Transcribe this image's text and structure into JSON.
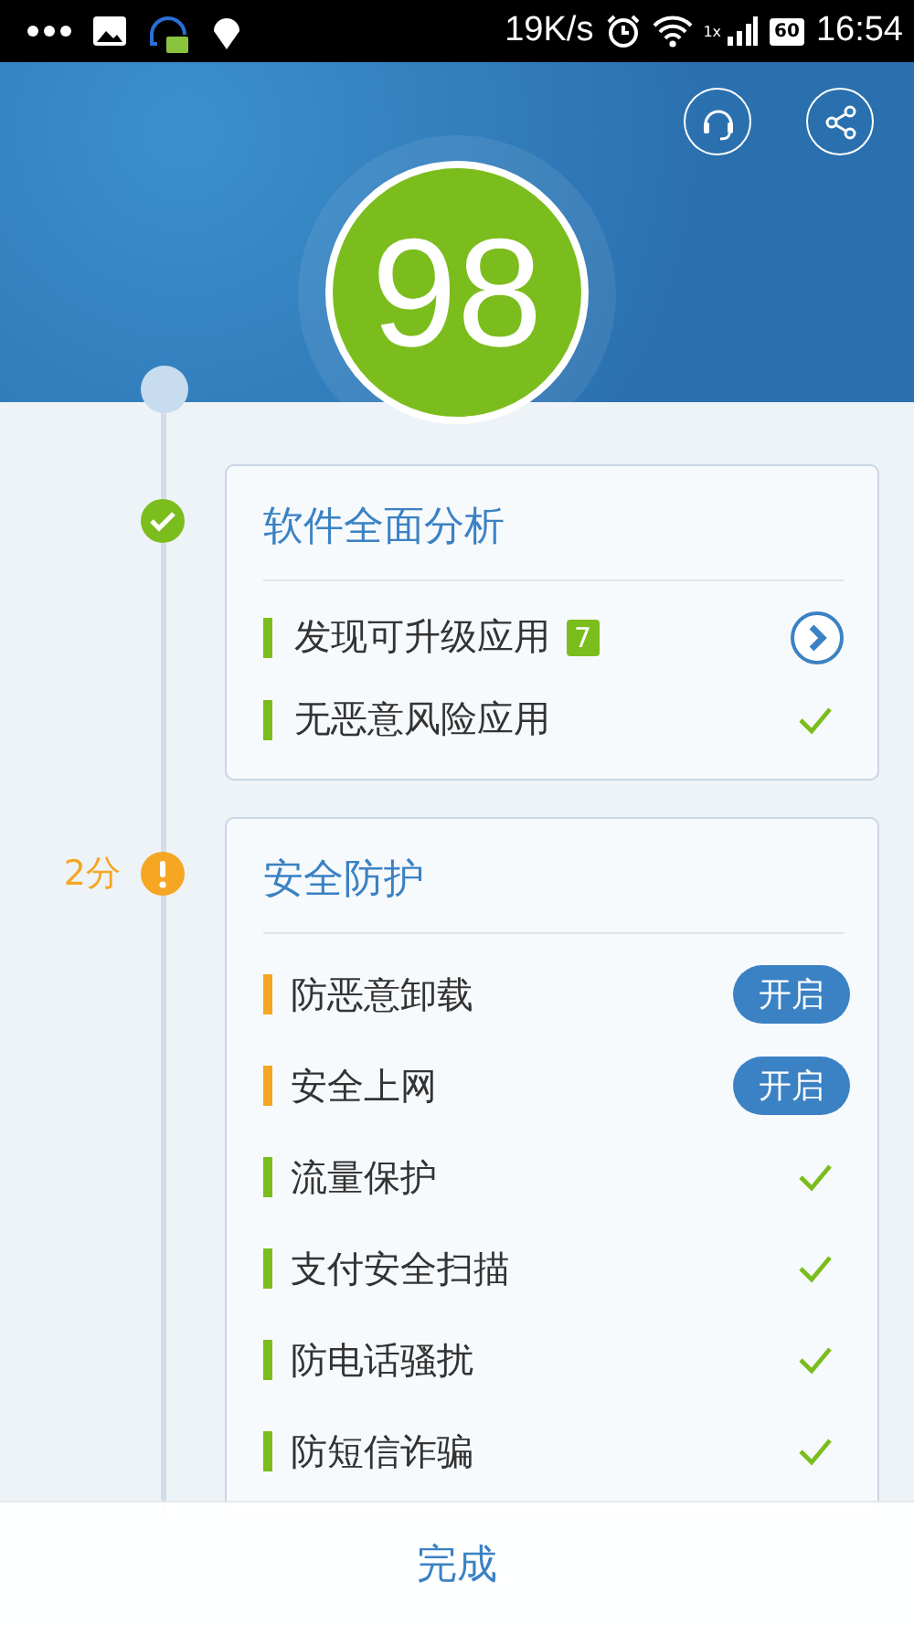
{
  "status_bar": {
    "speed": "19K/s",
    "network": "1x",
    "battery": "60",
    "time": "16:54"
  },
  "score": "98",
  "sections": [
    {
      "title": "软件全面分析",
      "kind": "ok",
      "items": [
        {
          "label": "发现可升级应用",
          "color": "#7cbd1e",
          "kind": "link",
          "badge": "7"
        },
        {
          "label": "无恶意风险应用",
          "color": "#7cbd1e",
          "kind": "check"
        }
      ]
    },
    {
      "title": "安全防护",
      "kind": "warn",
      "points": "2分",
      "items": [
        {
          "label": "防恶意卸载",
          "color": "#f5a623",
          "kind": "toggle",
          "action": "开启"
        },
        {
          "label": "安全上网",
          "color": "#f5a623",
          "kind": "toggle",
          "action": "开启"
        },
        {
          "label": "流量保护",
          "color": "#7cbd1e",
          "kind": "check"
        },
        {
          "label": "支付安全扫描",
          "color": "#7cbd1e",
          "kind": "check"
        },
        {
          "label": "防电话骚扰",
          "color": "#7cbd1e",
          "kind": "check"
        },
        {
          "label": "防短信诈骗",
          "color": "#7cbd1e",
          "kind": "check"
        }
      ]
    }
  ],
  "footer": {
    "button": "完成"
  }
}
